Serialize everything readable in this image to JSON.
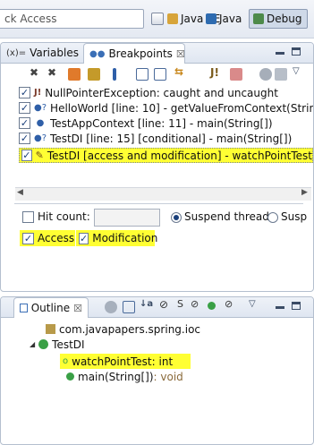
{
  "toolbar": {
    "quick_access_placeholder": "ck Access",
    "perspectives": [
      {
        "label": "Java EE"
      },
      {
        "label": "Java"
      },
      {
        "label": "Debug"
      }
    ]
  },
  "top_view": {
    "tabs": [
      {
        "label": "Variables",
        "prefix": "(x)="
      },
      {
        "label": "Breakpoints",
        "close": "☒"
      }
    ],
    "breakpoints": [
      {
        "label": "NullPointerException: caught and uncaught",
        "checked": true
      },
      {
        "label": "HelloWorld [line: 10] - getValueFromContext(Strin",
        "checked": true
      },
      {
        "label": "TestAppContext [line: 11] - main(String[])",
        "checked": true
      },
      {
        "label": "TestDI [line: 15] [conditional] - main(String[])",
        "checked": true
      },
      {
        "label": "TestDI [access and modification] - watchPointTest",
        "checked": true,
        "selected": true
      }
    ],
    "hit_count_label": "Hit count:",
    "hit_count_value": "",
    "suspend_thread_label": "Suspend thread",
    "suspend_vm_label": "Susp",
    "access_label": "Access",
    "modification_label": "Modification"
  },
  "bottom_view": {
    "tab_label": "Outline",
    "close": "☒",
    "tree": {
      "package": "com.javapapers.spring.ioc",
      "class": "TestDI",
      "field_name": "watchPointTest",
      "field_type": " : int",
      "method_name": "main(String[])",
      "method_type": " : void"
    }
  }
}
